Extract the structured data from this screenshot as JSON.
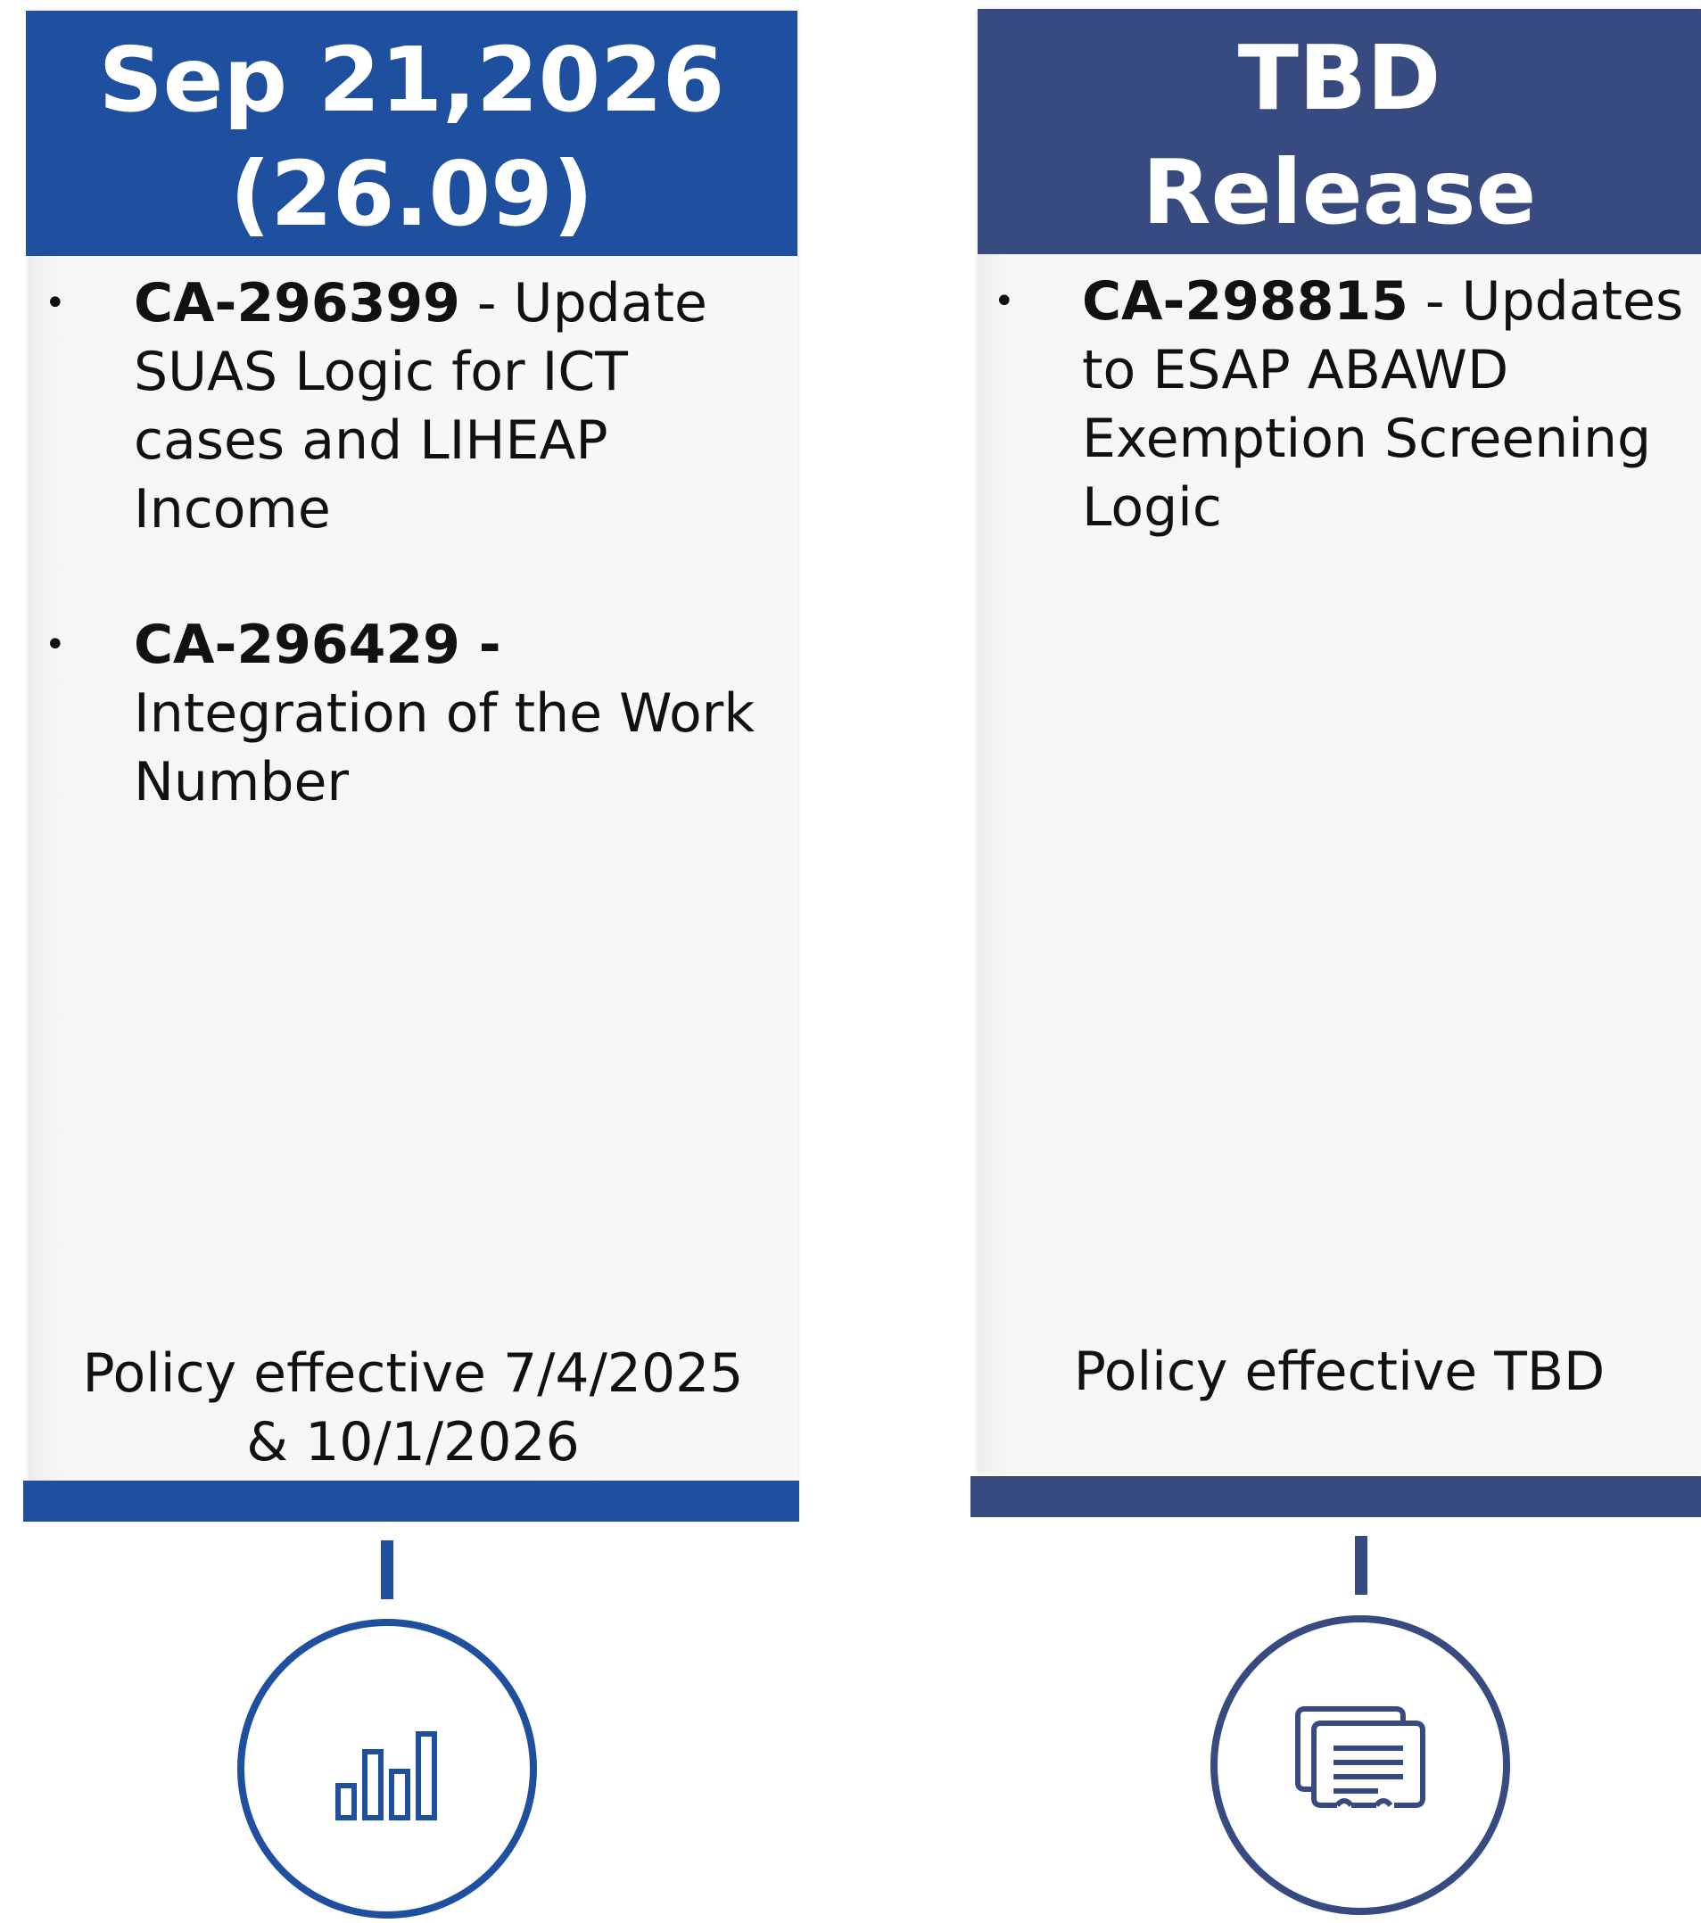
{
  "columns": [
    {
      "header": {
        "line1": "Sep 21,2026",
        "line2": "(26.09)"
      },
      "accent_color": "#1f4f9f",
      "items": [
        {
          "id": "CA-296399",
          "separator": " - ",
          "text": "Update SUAS Logic for ICT cases and LIHEAP Income"
        },
        {
          "id": "CA-296429",
          "separator": " - ",
          "text": "Integration of the Work Number"
        }
      ],
      "policy": {
        "line1": "Policy effective 7/4/2025",
        "line2": "& 10/1/2026"
      },
      "icon": "bar-chart-icon"
    },
    {
      "header": {
        "line1": "TBD",
        "line2": "Release"
      },
      "accent_color": "#374b80",
      "items": [
        {
          "id": "CA-298815",
          "separator": " - ",
          "text": "Updates to ESAP ABAWD Exemption Screening Logic"
        }
      ],
      "policy": {
        "line1": "Policy effective TBD",
        "line2": ""
      },
      "icon": "documents-icon"
    }
  ],
  "bullet_glyph": "•"
}
